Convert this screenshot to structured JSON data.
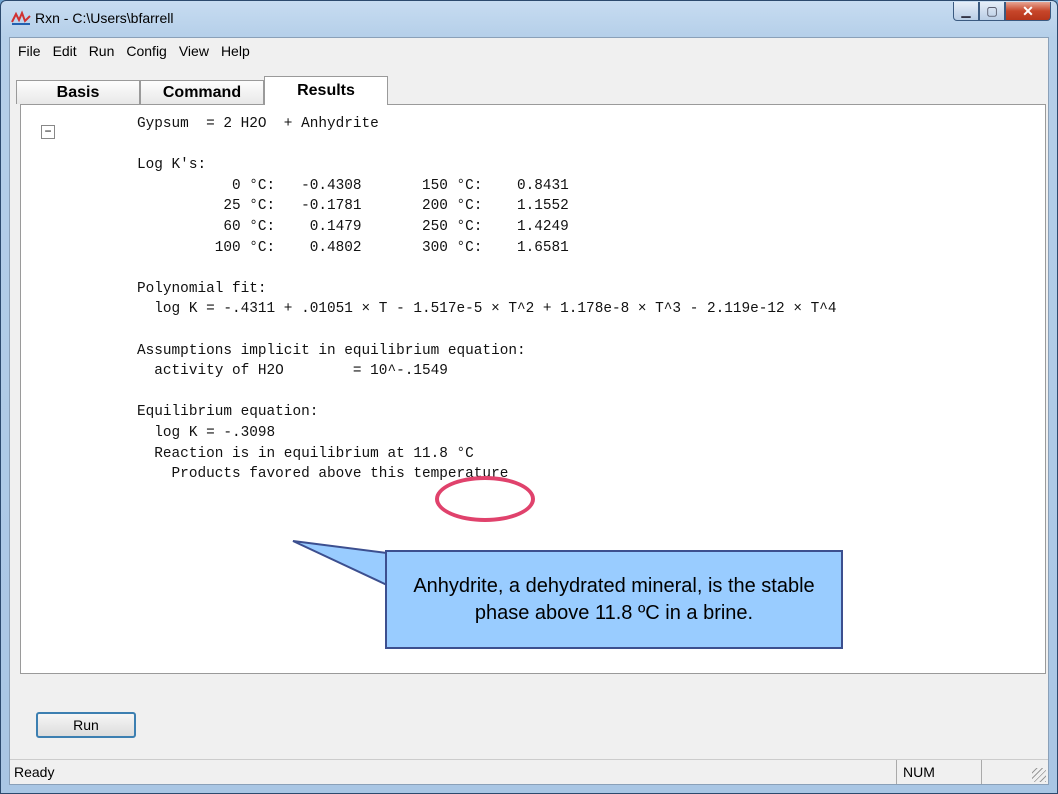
{
  "window": {
    "title": "Rxn - C:\\Users\\bfarrell",
    "min_label": "▁",
    "max_label": "▢",
    "close_label": "✕"
  },
  "menu": [
    "File",
    "Edit",
    "Run",
    "Config",
    "View",
    "Help"
  ],
  "tabs": [
    "Basis",
    "Command",
    "Results"
  ],
  "active_tab": "Results",
  "collapse_label": "−",
  "results_text": "Gypsum  = 2 H2O  + Anhydrite\n\nLog K's:\n           0 °C:   -0.4308       150 °C:    0.8431\n          25 °C:   -0.1781       200 °C:    1.1552\n          60 °C:    0.1479       250 °C:    1.4249\n         100 °C:    0.4802       300 °C:    1.6581\n\nPolynomial fit:\n  log K = -.4311 + .01051 × T - 1.517e-5 × T^2 + 1.178e-8 × T^3 - 2.119e-12 × T^4\n\nAssumptions implicit in equilibrium equation:\n  activity of H2O        = 10^-.1549\n\nEquilibrium equation:\n  log K = -.3098\n  Reaction is in equilibrium at 11.8 °C\n    Products favored above this temperature",
  "callout": "Anhydrite, a dehydrated mineral, is the stable phase above 11.8 ºC in a brine.",
  "run_button": "Run",
  "status": {
    "text": "Ready",
    "num": "NUM"
  },
  "colors": {
    "callout_fill": "#99ccff",
    "callout_border": "#3c4f8f",
    "highlight": "#e0426c",
    "frame": "#b5cfe9"
  }
}
